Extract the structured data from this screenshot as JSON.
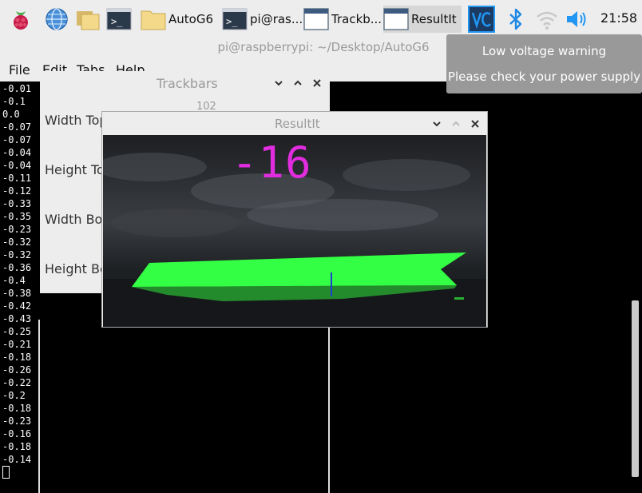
{
  "taskbar": {
    "launchers": [
      "raspberry-menu-icon",
      "web-browser-icon",
      "file-manager-icon",
      "terminal-icon"
    ],
    "tasks": [
      {
        "label": "AutoG6",
        "icon": "folder-icon"
      },
      {
        "label": "pi@ras...",
        "icon": "terminal-icon"
      },
      {
        "label": "Trackb...",
        "icon": "window-icon"
      },
      {
        "label": "ResultIt",
        "icon": "window-icon"
      }
    ],
    "tray": [
      "vnc-icon",
      "bluetooth-icon",
      "wifi-icon",
      "volume-icon"
    ],
    "clock": "21:58"
  },
  "terminal": {
    "title": "pi@raspberrypi: ~/Desktop/AutoG6",
    "menu": [
      "File",
      "Edit",
      "Tabs",
      "Help"
    ],
    "lines": "-0.01\n-0.1\n0.0\n-0.07\n-0.07\n-0.04\n-0.04\n-0.11\n-0.12\n-0.33\n-0.35\n-0.23\n-0.32\n-0.32\n-0.36\n-0.4\n-0.38\n-0.42\n-0.43\n-0.25\n-0.21\n-0.18\n-0.26\n-0.22\n-0.2\n-0.18\n-0.23\n-0.16\n-0.18\n-0.14"
  },
  "trackbars": {
    "title": "Trackbars",
    "value": "102",
    "labels": [
      "Width Top",
      "Height Top",
      "Width Bot",
      "Height Bot"
    ]
  },
  "result": {
    "title": "ResultIt",
    "number": "-16"
  },
  "notification": {
    "title": "Low voltage warning",
    "body": "Please check your power supply"
  },
  "colors": {
    "panel": "#ededed",
    "overlay_text": "#e22ce0",
    "lane": "#33ff44",
    "bluetooth": "#1e88e5",
    "tray_blue": "#2196f3"
  }
}
